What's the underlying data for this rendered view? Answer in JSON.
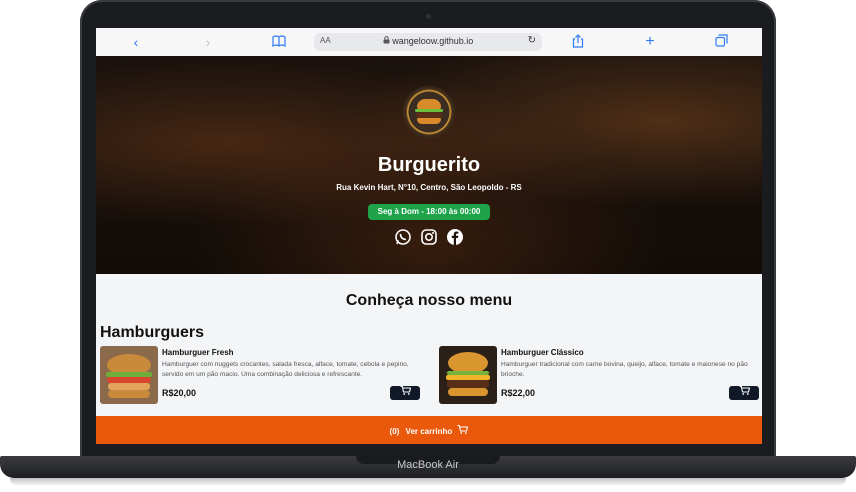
{
  "device": {
    "label": "MacBook Air"
  },
  "browser": {
    "text_size_label": "AA",
    "url": "wangeloow.github.io",
    "icons": [
      "back-icon",
      "forward-icon",
      "bookmarks-icon",
      "lock-icon",
      "reload-icon",
      "share-icon",
      "new-tab-icon",
      "tabs-icon"
    ]
  },
  "hero": {
    "title": "Burguerito",
    "address": "Rua Kevin Hart, N°10, Centro, São Leopoldo - RS",
    "hours": "Seg à Dom - 18:00 às 00:00",
    "socials": [
      "whatsapp-icon",
      "instagram-icon",
      "facebook-icon"
    ]
  },
  "menu": {
    "heading": "Conheça nosso menu",
    "categories": [
      {
        "name": "Hamburguers",
        "items": [
          {
            "name": "Hamburguer Fresh",
            "description": "Hamburguer com nuggets crocantes, salada fresca, alface, tomate, cebola e pepino, servido em um pão macio. Uma combinação deliciosa e refrescante.",
            "price": "R$20,00"
          },
          {
            "name": "Hamburguer Clássico",
            "description": "Hamburguer tradicional com carne bovina, queijo, alface, tomate e maionese no pão brioche.",
            "price": "R$22,00"
          }
        ]
      }
    ]
  },
  "cart": {
    "count": "(0)",
    "label": "Ver carrinho"
  },
  "colors": {
    "accent": "#ea580c",
    "hours_badge": "#1fa34a",
    "button_dark": "#111827"
  }
}
